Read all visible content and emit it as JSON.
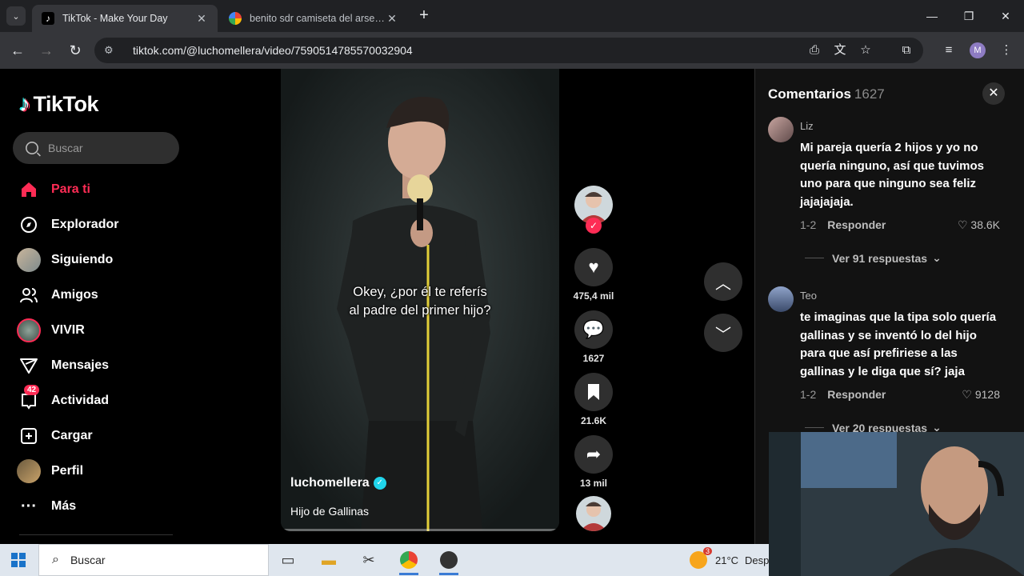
{
  "browser": {
    "tabs": [
      {
        "title": "TikTok - Make Your Day",
        "active": true
      },
      {
        "title": "benito sdr camiseta del arsenal",
        "active": false
      }
    ],
    "url": "tiktok.com/@luchomellera/video/7590514785570032904",
    "profile_initial": "M"
  },
  "sidebar": {
    "logo": "TikTok",
    "search_placeholder": "Buscar",
    "items": [
      {
        "label": "Para ti",
        "icon": "home-icon"
      },
      {
        "label": "Explorador",
        "icon": "compass-icon"
      },
      {
        "label": "Siguiendo",
        "icon": "following-avatar"
      },
      {
        "label": "Amigos",
        "icon": "friends-icon"
      },
      {
        "label": "VIVIR",
        "icon": "live-avatar"
      },
      {
        "label": "Mensajes",
        "icon": "send-icon"
      },
      {
        "label": "Actividad",
        "icon": "inbox-icon",
        "badge": "42"
      },
      {
        "label": "Cargar",
        "icon": "upload-icon"
      },
      {
        "label": "Perfil",
        "icon": "profile-avatar"
      },
      {
        "label": "Más",
        "icon": "more-icon"
      }
    ]
  },
  "video": {
    "caption_line1": "Okey, ¿por él te referís",
    "caption_line2": "al padre del primer hijo?",
    "username": "luchomellera",
    "description": "Hijo de Gallinas"
  },
  "actions": {
    "likes": "475,4 mil",
    "comments": "1627",
    "saves": "21.6K",
    "shares": "13 mil"
  },
  "comments": {
    "title": "Comentarios",
    "count": "1627",
    "list": [
      {
        "user": "Liz",
        "text": "Mi pareja quería 2 hijos y yo no quería ninguno, así que tuvimos uno para que ninguno sea feliz jajajajaja.",
        "date": "1-2",
        "reply": "Responder",
        "likes": "38.6K",
        "more": "Ver 91 respuestas"
      },
      {
        "user": "Teo",
        "text": "te imaginas que la tipa solo quería gallinas y se inventó lo del hijo para que así prefiriese a las gallinas y le diga que sí? jaja",
        "date": "1-2",
        "reply": "Responder",
        "likes": "9128",
        "more": "Ver 20 respuestas"
      }
    ]
  },
  "taskbar": {
    "search_label": "Buscar",
    "weather_temp": "21°C",
    "weather_text": "Desp",
    "weather_badge": "3"
  },
  "colors": {
    "accent": "#fe2c55",
    "panel": "#121212",
    "chrome_dark": "#202124"
  }
}
